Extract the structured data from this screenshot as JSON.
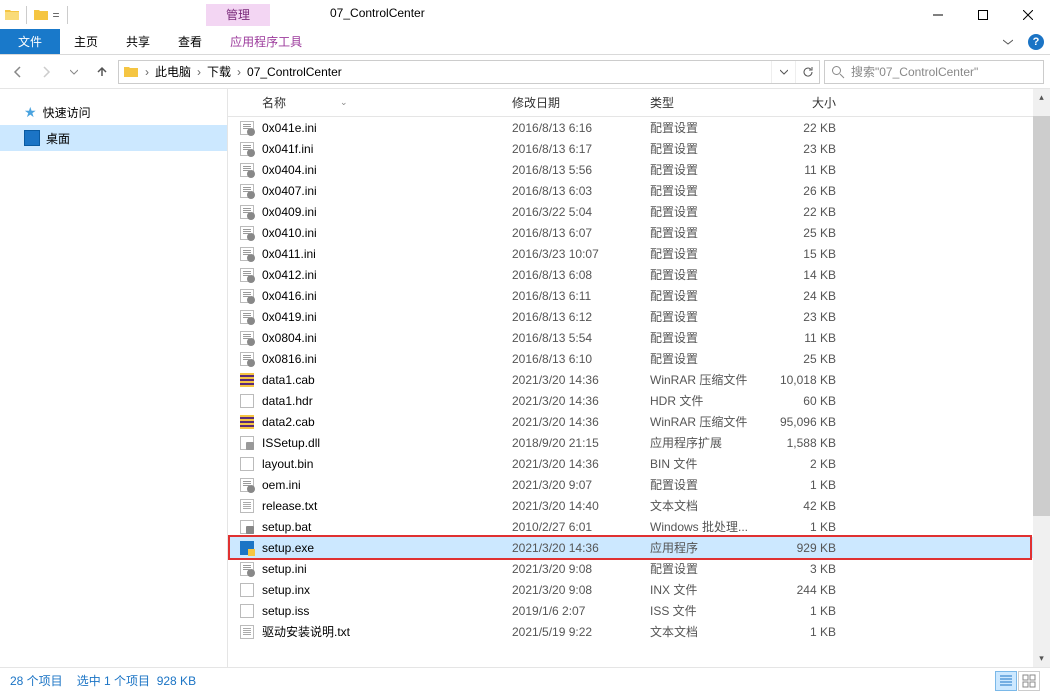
{
  "window": {
    "title": "07_ControlCenter",
    "manage_tab": "管理"
  },
  "ribbon": {
    "file": "文件",
    "home": "主页",
    "share": "共享",
    "view": "查看",
    "app_tools": "应用程序工具"
  },
  "address": {
    "this_pc": "此电脑",
    "downloads": "下载",
    "folder": "07_ControlCenter"
  },
  "search": {
    "placeholder": "搜索\"07_ControlCenter\""
  },
  "sidebar": {
    "quick_access": "快速访问",
    "desktop": "桌面"
  },
  "columns": {
    "name": "名称",
    "date": "修改日期",
    "type": "类型",
    "size": "大小"
  },
  "files": [
    {
      "icon": "ini",
      "name": "0x041e.ini",
      "date": "2016/8/13 6:16",
      "type": "配置设置",
      "size": "22 KB"
    },
    {
      "icon": "ini",
      "name": "0x041f.ini",
      "date": "2016/8/13 6:17",
      "type": "配置设置",
      "size": "23 KB"
    },
    {
      "icon": "ini",
      "name": "0x0404.ini",
      "date": "2016/8/13 5:56",
      "type": "配置设置",
      "size": "11 KB"
    },
    {
      "icon": "ini",
      "name": "0x0407.ini",
      "date": "2016/8/13 6:03",
      "type": "配置设置",
      "size": "26 KB"
    },
    {
      "icon": "ini",
      "name": "0x0409.ini",
      "date": "2016/3/22 5:04",
      "type": "配置设置",
      "size": "22 KB"
    },
    {
      "icon": "ini",
      "name": "0x0410.ini",
      "date": "2016/8/13 6:07",
      "type": "配置设置",
      "size": "25 KB"
    },
    {
      "icon": "ini",
      "name": "0x0411.ini",
      "date": "2016/3/23 10:07",
      "type": "配置设置",
      "size": "15 KB"
    },
    {
      "icon": "ini",
      "name": "0x0412.ini",
      "date": "2016/8/13 6:08",
      "type": "配置设置",
      "size": "14 KB"
    },
    {
      "icon": "ini",
      "name": "0x0416.ini",
      "date": "2016/8/13 6:11",
      "type": "配置设置",
      "size": "24 KB"
    },
    {
      "icon": "ini",
      "name": "0x0419.ini",
      "date": "2016/8/13 6:12",
      "type": "配置设置",
      "size": "23 KB"
    },
    {
      "icon": "ini",
      "name": "0x0804.ini",
      "date": "2016/8/13 5:54",
      "type": "配置设置",
      "size": "11 KB"
    },
    {
      "icon": "ini",
      "name": "0x0816.ini",
      "date": "2016/8/13 6:10",
      "type": "配置设置",
      "size": "25 KB"
    },
    {
      "icon": "cab",
      "name": "data1.cab",
      "date": "2021/3/20 14:36",
      "type": "WinRAR 压缩文件",
      "size": "10,018 KB"
    },
    {
      "icon": "hdr",
      "name": "data1.hdr",
      "date": "2021/3/20 14:36",
      "type": "HDR 文件",
      "size": "60 KB"
    },
    {
      "icon": "cab",
      "name": "data2.cab",
      "date": "2021/3/20 14:36",
      "type": "WinRAR 压缩文件",
      "size": "95,096 KB"
    },
    {
      "icon": "dll",
      "name": "ISSetup.dll",
      "date": "2018/9/20 21:15",
      "type": "应用程序扩展",
      "size": "1,588 KB"
    },
    {
      "icon": "hdr",
      "name": "layout.bin",
      "date": "2021/3/20 14:36",
      "type": "BIN 文件",
      "size": "2 KB"
    },
    {
      "icon": "ini",
      "name": "oem.ini",
      "date": "2021/3/20 9:07",
      "type": "配置设置",
      "size": "1 KB"
    },
    {
      "icon": "txt",
      "name": "release.txt",
      "date": "2021/3/20 14:40",
      "type": "文本文档",
      "size": "42 KB"
    },
    {
      "icon": "bat",
      "name": "setup.bat",
      "date": "2010/2/27 6:01",
      "type": "Windows 批处理...",
      "size": "1 KB"
    },
    {
      "icon": "exe",
      "name": "setup.exe",
      "date": "2021/3/20 14:36",
      "type": "应用程序",
      "size": "929 KB",
      "selected": true,
      "highlight": true
    },
    {
      "icon": "ini",
      "name": "setup.ini",
      "date": "2021/3/20 9:08",
      "type": "配置设置",
      "size": "3 KB"
    },
    {
      "icon": "hdr",
      "name": "setup.inx",
      "date": "2021/3/20 9:08",
      "type": "INX 文件",
      "size": "244 KB"
    },
    {
      "icon": "hdr",
      "name": "setup.iss",
      "date": "2019/1/6 2:07",
      "type": "ISS 文件",
      "size": "1 KB"
    },
    {
      "icon": "txt",
      "name": "驱动安装说明.txt",
      "date": "2021/5/19 9:22",
      "type": "文本文档",
      "size": "1 KB"
    }
  ],
  "status": {
    "item_count": "28 个项目",
    "selection": "选中 1 个项目",
    "selection_size": "928 KB"
  }
}
